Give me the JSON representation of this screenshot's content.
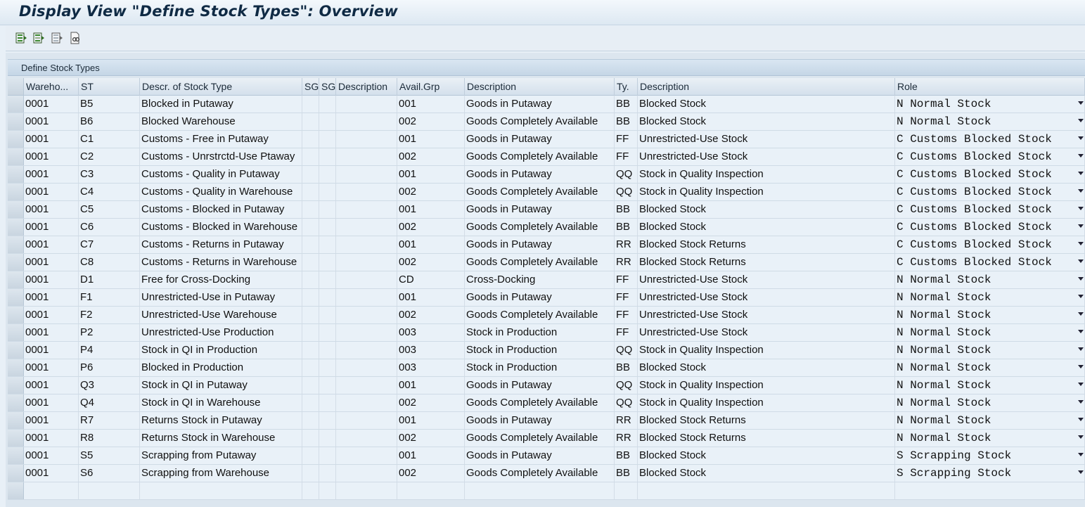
{
  "window": {
    "title": "Display View \"Define Stock Types\": Overview"
  },
  "toolbar": {
    "buttons": [
      {
        "icon": "select-all-icon"
      },
      {
        "icon": "select-block-icon"
      },
      {
        "icon": "deselect-all-icon"
      },
      {
        "icon": "find-icon"
      }
    ]
  },
  "panel": {
    "title": "Define Stock Types"
  },
  "table": {
    "columns": [
      "Wareho...",
      "ST",
      "Descr. of Stock Type",
      "SG",
      "SG",
      "Description",
      "Avail.Grp",
      "Description",
      "Ty.",
      "Description",
      "Role"
    ],
    "rows": [
      [
        "0001",
        "B5",
        "Blocked in Putaway",
        "",
        "",
        "",
        "001",
        "Goods in Putaway",
        "BB",
        "Blocked Stock",
        "N Normal Stock"
      ],
      [
        "0001",
        "B6",
        "Blocked Warehouse",
        "",
        "",
        "",
        "002",
        "Goods Completely Available",
        "BB",
        "Blocked Stock",
        "N Normal Stock"
      ],
      [
        "0001",
        "C1",
        "Customs - Free in Putaway",
        "",
        "",
        "",
        "001",
        "Goods in Putaway",
        "FF",
        "Unrestricted-Use Stock",
        "C Customs Blocked Stock"
      ],
      [
        "0001",
        "C2",
        "Customs - Unrstrctd-Use Ptaway",
        "",
        "",
        "",
        "002",
        "Goods Completely Available",
        "FF",
        "Unrestricted-Use Stock",
        "C Customs Blocked Stock"
      ],
      [
        "0001",
        "C3",
        "Customs - Quality in Putaway",
        "",
        "",
        "",
        "001",
        "Goods in Putaway",
        "QQ",
        "Stock in Quality Inspection",
        "C Customs Blocked Stock"
      ],
      [
        "0001",
        "C4",
        "Customs - Quality in Warehouse",
        "",
        "",
        "",
        "002",
        "Goods Completely Available",
        "QQ",
        "Stock in Quality Inspection",
        "C Customs Blocked Stock"
      ],
      [
        "0001",
        "C5",
        "Customs - Blocked in Putaway",
        "",
        "",
        "",
        "001",
        "Goods in Putaway",
        "BB",
        "Blocked Stock",
        "C Customs Blocked Stock"
      ],
      [
        "0001",
        "C6",
        "Customs - Blocked in Warehouse",
        "",
        "",
        "",
        "002",
        "Goods Completely Available",
        "BB",
        "Blocked Stock",
        "C Customs Blocked Stock"
      ],
      [
        "0001",
        "C7",
        "Customs - Returns in Putaway",
        "",
        "",
        "",
        "001",
        "Goods in Putaway",
        "RR",
        "Blocked Stock Returns",
        "C Customs Blocked Stock"
      ],
      [
        "0001",
        "C8",
        "Customs - Returns in Warehouse",
        "",
        "",
        "",
        "002",
        "Goods Completely Available",
        "RR",
        "Blocked Stock Returns",
        "C Customs Blocked Stock"
      ],
      [
        "0001",
        "D1",
        "Free for Cross-Docking",
        "",
        "",
        "",
        "CD",
        "Cross-Docking",
        "FF",
        "Unrestricted-Use Stock",
        "N Normal Stock"
      ],
      [
        "0001",
        "F1",
        "Unrestricted-Use in Putaway",
        "",
        "",
        "",
        "001",
        "Goods in Putaway",
        "FF",
        "Unrestricted-Use Stock",
        "N Normal Stock"
      ],
      [
        "0001",
        "F2",
        "Unrestricted-Use Warehouse",
        "",
        "",
        "",
        "002",
        "Goods Completely Available",
        "FF",
        "Unrestricted-Use Stock",
        "N Normal Stock"
      ],
      [
        "0001",
        "P2",
        "Unrestricted-Use Production",
        "",
        "",
        "",
        "003",
        "Stock in Production",
        "FF",
        "Unrestricted-Use Stock",
        "N Normal Stock"
      ],
      [
        "0001",
        "P4",
        "Stock in QI in Production",
        "",
        "",
        "",
        "003",
        "Stock in Production",
        "QQ",
        "Stock in Quality Inspection",
        "N Normal Stock"
      ],
      [
        "0001",
        "P6",
        "Blocked in Production",
        "",
        "",
        "",
        "003",
        "Stock in Production",
        "BB",
        "Blocked Stock",
        "N Normal Stock"
      ],
      [
        "0001",
        "Q3",
        "Stock in QI in Putaway",
        "",
        "",
        "",
        "001",
        "Goods in Putaway",
        "QQ",
        "Stock in Quality Inspection",
        "N Normal Stock"
      ],
      [
        "0001",
        "Q4",
        "Stock in QI in Warehouse",
        "",
        "",
        "",
        "002",
        "Goods Completely Available",
        "QQ",
        "Stock in Quality Inspection",
        "N Normal Stock"
      ],
      [
        "0001",
        "R7",
        "Returns Stock in Putaway",
        "",
        "",
        "",
        "001",
        "Goods in Putaway",
        "RR",
        "Blocked Stock Returns",
        "N Normal Stock"
      ],
      [
        "0001",
        "R8",
        "Returns Stock in Warehouse",
        "",
        "",
        "",
        "002",
        "Goods Completely Available",
        "RR",
        "Blocked Stock Returns",
        "N Normal Stock"
      ],
      [
        "0001",
        "S5",
        "Scrapping from Putaway",
        "",
        "",
        "",
        "001",
        "Goods in Putaway",
        "BB",
        "Blocked Stock",
        "S Scrapping Stock"
      ],
      [
        "0001",
        "S6",
        "Scrapping from Warehouse",
        "",
        "",
        "",
        "002",
        "Goods Completely Available",
        "BB",
        "Blocked Stock",
        "S Scrapping Stock"
      ],
      [
        "",
        "",
        "",
        "",
        "",
        "",
        "",
        "",
        "",
        "",
        ""
      ]
    ]
  }
}
